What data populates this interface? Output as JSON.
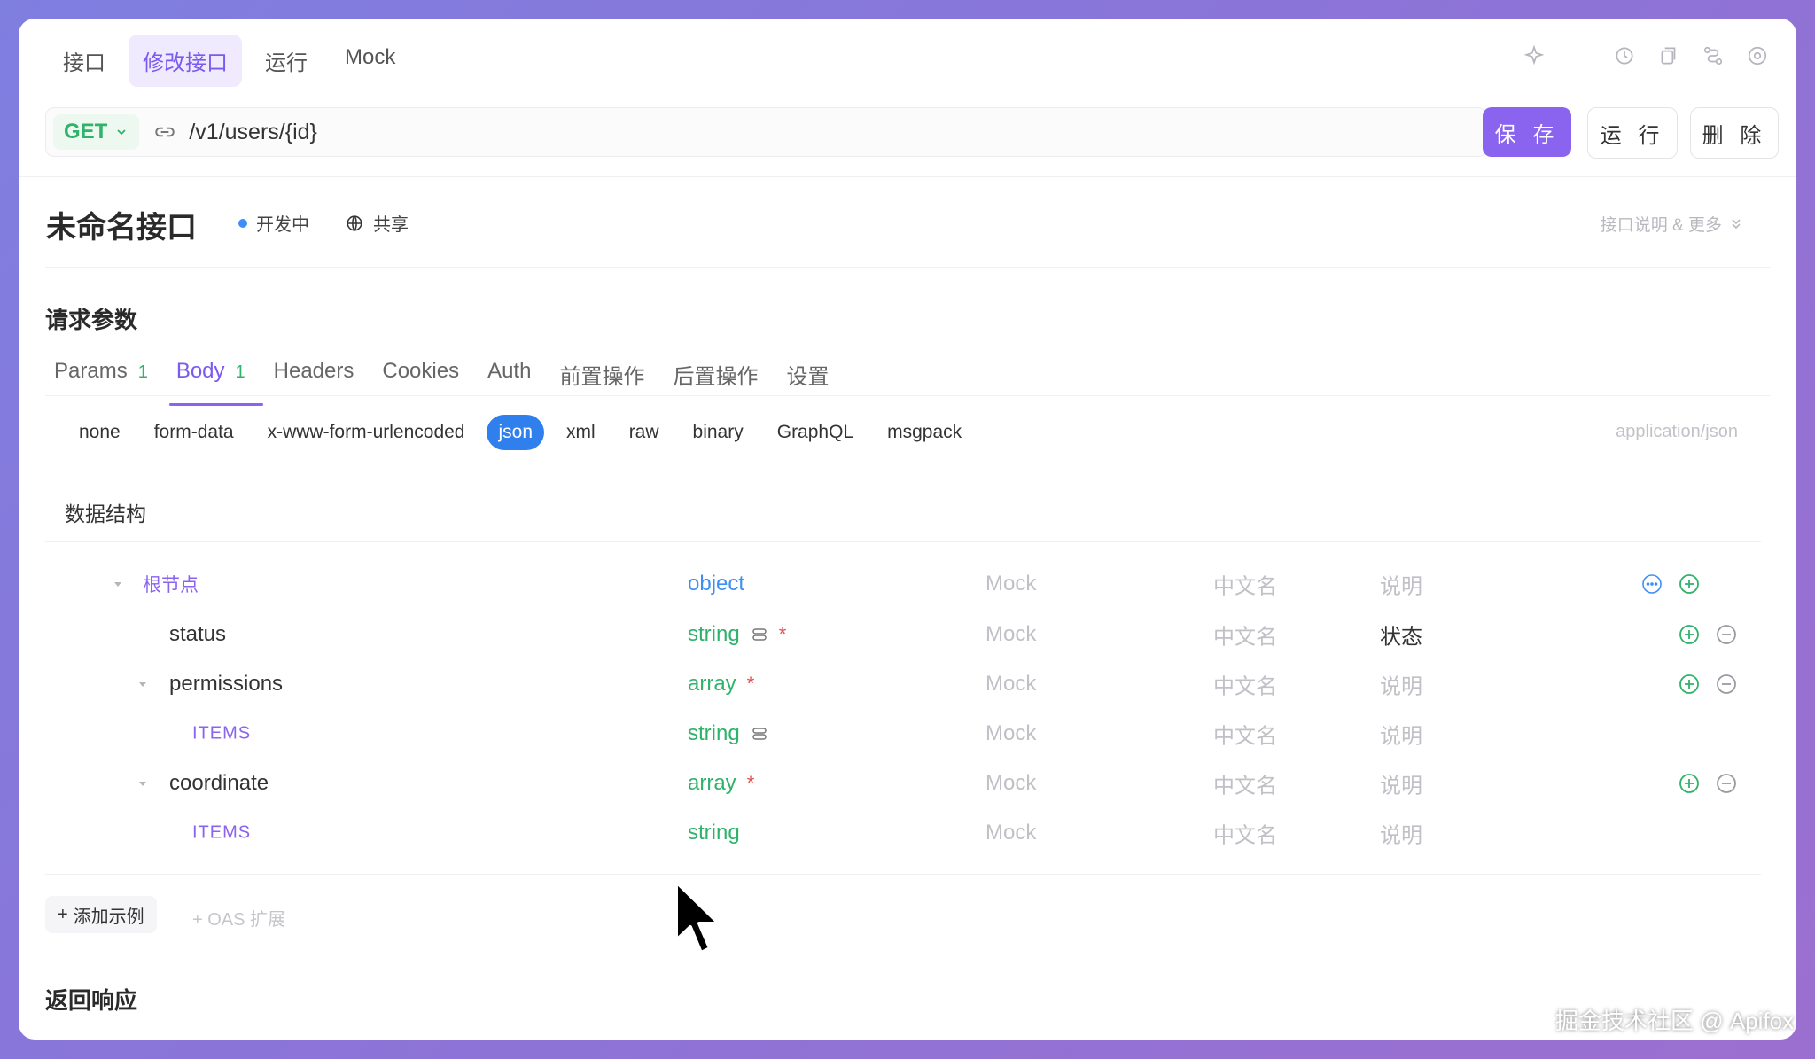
{
  "top_tabs": [
    {
      "label": "接口"
    },
    {
      "label": "修改接口"
    },
    {
      "label": "运行"
    },
    {
      "label": "Mock"
    }
  ],
  "top_icons": [
    "sparkle-icon",
    "history-icon",
    "copy-icon",
    "flow-icon",
    "settings-icon"
  ],
  "request": {
    "method": "GET",
    "path": "/v1/users/{id}",
    "save_label": "保 存",
    "run_label": "运 行",
    "delete_label": "删 除"
  },
  "api": {
    "title": "未命名接口",
    "status": "开发中",
    "share": "共享",
    "more": "接口说明 & 更多"
  },
  "request_params": {
    "title": "请求参数",
    "tabs": [
      {
        "label": "Params",
        "count": "1"
      },
      {
        "label": "Body",
        "count": "1"
      },
      {
        "label": "Headers"
      },
      {
        "label": "Cookies"
      },
      {
        "label": "Auth"
      },
      {
        "label": "前置操作"
      },
      {
        "label": "后置操作"
      },
      {
        "label": "设置"
      }
    ],
    "body_types": [
      "none",
      "form-data",
      "x-www-form-urlencoded",
      "json",
      "xml",
      "raw",
      "binary",
      "GraphQL",
      "msgpack"
    ],
    "active_body_type": "json",
    "content_type": "application/json",
    "structure_label": "数据结构"
  },
  "schema_rows": [
    {
      "name": "根节点",
      "type": "object",
      "mock": "Mock",
      "cn": "中文名",
      "desc": "说明"
    },
    {
      "name": "status",
      "type": "string",
      "mock": "Mock",
      "cn": "中文名",
      "desc": "状态",
      "required": "*"
    },
    {
      "name": "permissions",
      "type": "array",
      "mock": "Mock",
      "cn": "中文名",
      "desc": "说明",
      "required": "*"
    },
    {
      "name": "ITEMS",
      "type": "string",
      "mock": "Mock",
      "cn": "中文名",
      "desc": "说明"
    },
    {
      "name": "coordinate",
      "type": "array",
      "mock": "Mock",
      "cn": "中文名",
      "desc": "说明",
      "required": "*"
    },
    {
      "name": "ITEMS",
      "type": "string",
      "mock": "Mock",
      "cn": "中文名",
      "desc": "说明"
    }
  ],
  "actions": {
    "add_example": "添加示例",
    "oas_ext": "+ OAS 扩展"
  },
  "response": {
    "title": "返回响应"
  },
  "watermark": "掘金技术社区 @ Apifox",
  "colors": {
    "accent": "#8a63ef",
    "method_green": "#2fb36b",
    "json_blue": "#2f80ed"
  }
}
